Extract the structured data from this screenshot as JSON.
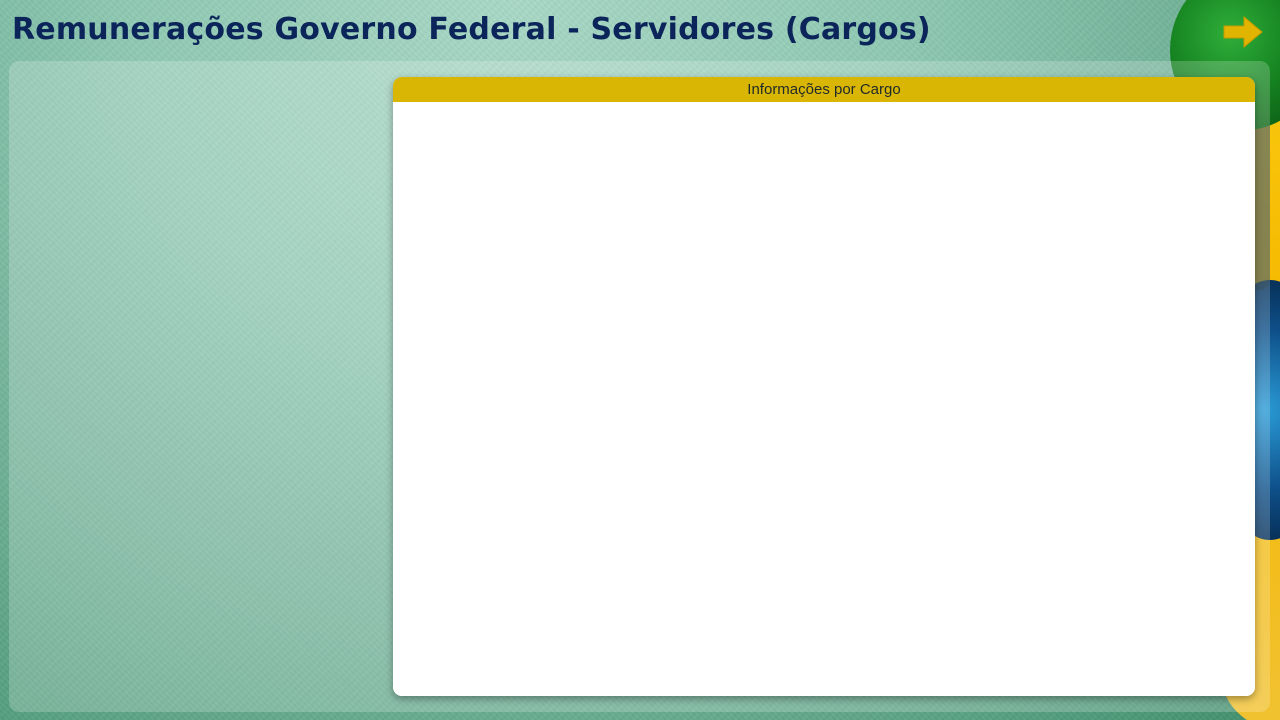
{
  "header": {
    "title": "Remunerações Governo Federal - Servidores (Cargos)",
    "next_icon": "arrow-right-icon"
  },
  "info_card": {
    "title": "Informações por Cargo"
  },
  "colors": {
    "title": "#0b2459",
    "card_header": "#d9b604",
    "arrow": "#e1b400"
  }
}
